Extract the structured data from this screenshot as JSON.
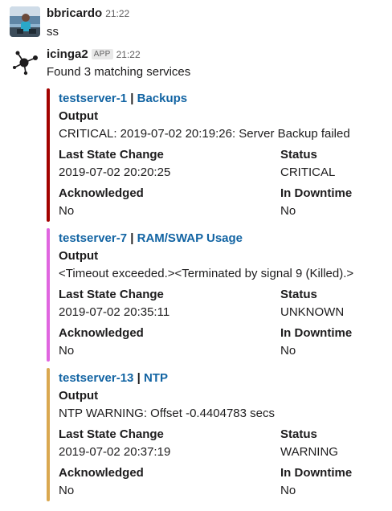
{
  "messages": [
    {
      "user": "bbricardo",
      "time": "21:22",
      "text": "ss"
    },
    {
      "user": "icinga2",
      "badge": "APP",
      "time": "21:22",
      "text": "Found 3 matching services"
    }
  ],
  "attachments": [
    {
      "color": "#a30200",
      "host": "testserver-1",
      "separator": " | ",
      "service": "Backups",
      "output_label": "Output",
      "output": "CRITICAL: 2019-07-02 20:19:26: Server Backup failed",
      "last_state_change_label": "Last State Change",
      "last_state_change": "2019-07-02 20:20:25",
      "status_label": "Status",
      "status": "CRITICAL",
      "acknowledged_label": "Acknowledged",
      "acknowledged": "No",
      "downtime_label": "In Downtime",
      "downtime": "No"
    },
    {
      "color": "#e066e0",
      "host": "testserver-7",
      "separator": " | ",
      "service": "RAM/SWAP Usage",
      "output_label": "Output",
      "output": "<Timeout exceeded.><Terminated by signal 9 (Killed).>",
      "last_state_change_label": "Last State Change",
      "last_state_change": "2019-07-02 20:35:11",
      "status_label": "Status",
      "status": "UNKNOWN",
      "acknowledged_label": "Acknowledged",
      "acknowledged": "No",
      "downtime_label": "In Downtime",
      "downtime": "No"
    },
    {
      "color": "#daa850",
      "host": "testserver-13",
      "separator": " | ",
      "service": "NTP",
      "output_label": "Output",
      "output": "NTP WARNING: Offset -0.4404783 secs",
      "last_state_change_label": "Last State Change",
      "last_state_change": "2019-07-02 20:37:19",
      "status_label": "Status",
      "status": "WARNING",
      "acknowledged_label": "Acknowledged",
      "acknowledged": "No",
      "downtime_label": "In Downtime",
      "downtime": "No"
    }
  ],
  "icons": {
    "user_avatar": "user-photo-avatar",
    "bot_avatar": "icinga2-logo-icon"
  }
}
